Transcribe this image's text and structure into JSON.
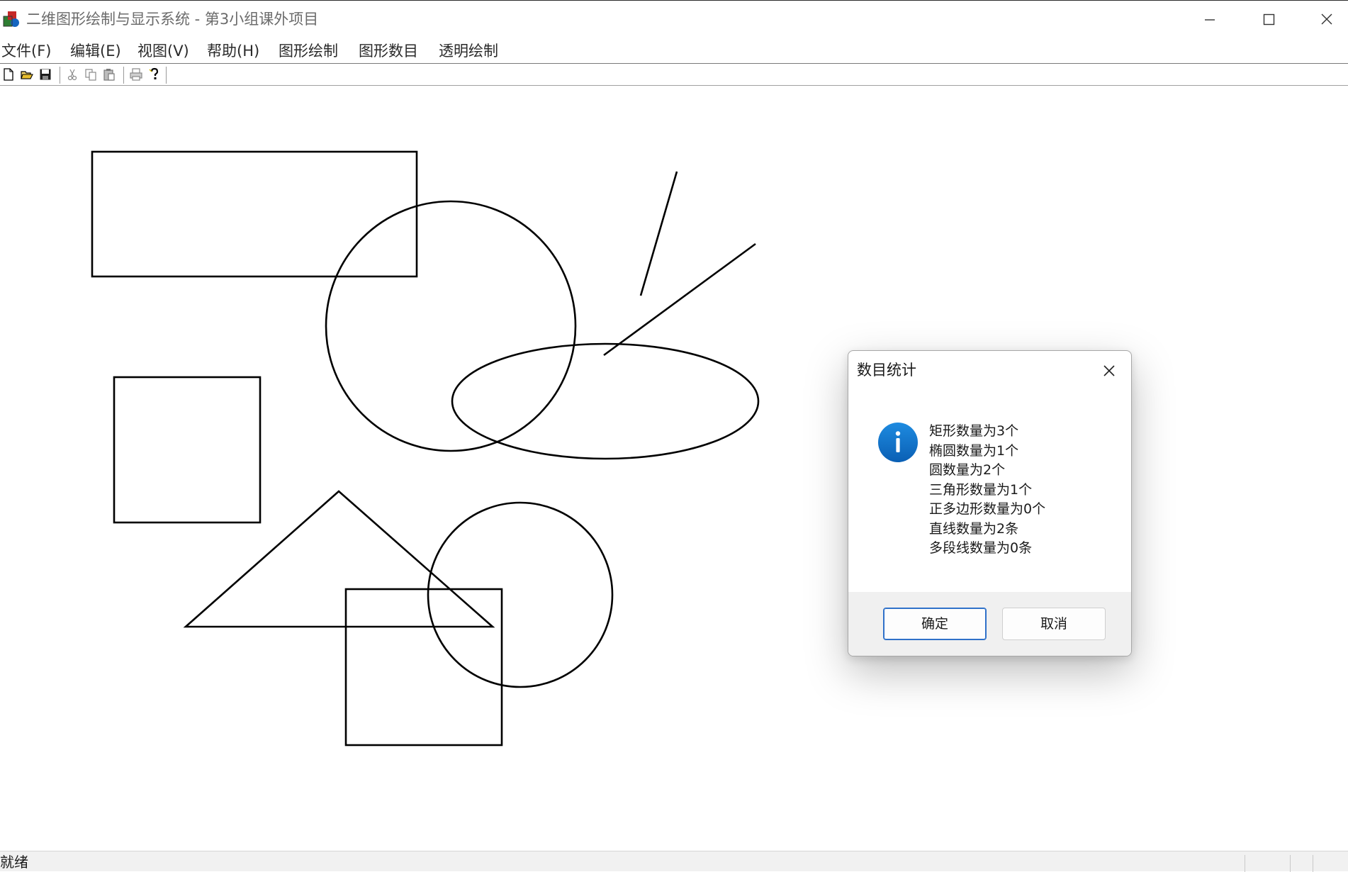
{
  "window": {
    "title": "二维图形绘制与显示系统 - 第3小组课外项目",
    "controls": [
      "minimize",
      "maximize",
      "close"
    ]
  },
  "menu": {
    "items": [
      "文件(F)",
      "编辑(E)",
      "视图(V)",
      "帮助(H)",
      "图形绘制",
      "图形数目",
      "透明绘制"
    ]
  },
  "toolbar": {
    "icons": [
      "new-file-icon",
      "open-folder-icon",
      "save-icon",
      "cut-icon",
      "copy-icon",
      "paste-icon",
      "print-icon",
      "help-icon"
    ]
  },
  "canvas": {
    "shapes": [
      "rectangle",
      "rectangle",
      "rectangle",
      "circle",
      "circle",
      "ellipse",
      "triangle",
      "line",
      "line"
    ],
    "stroke_color": "#000000"
  },
  "dialog": {
    "title": "数目统计",
    "icon": "info-icon",
    "lines": [
      "矩形数量为3个",
      "椭圆数量为1个",
      "圆数量为2个",
      "三角形数量为1个",
      "正多边形数量为0个",
      "直线数量为2条",
      "多段线数量为0条"
    ],
    "ok_label": "确定",
    "cancel_label": "取消",
    "accent_color": "#0f6cbd"
  },
  "status": {
    "text": "就绪"
  }
}
